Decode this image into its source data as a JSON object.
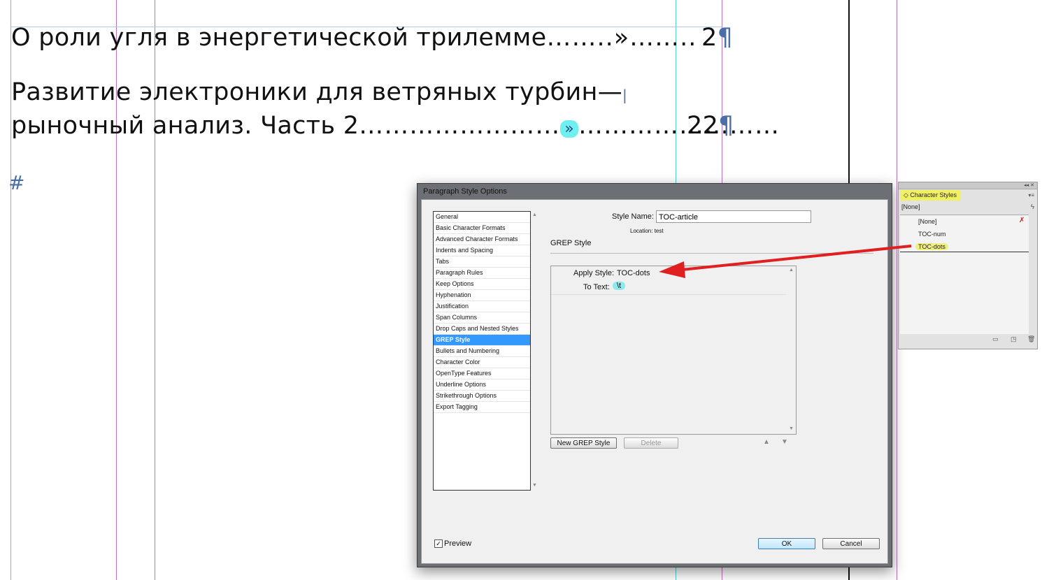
{
  "document": {
    "line1": {
      "text": "О роли угля в энергетической трилемме",
      "leader": "……..»……..",
      "page": "2"
    },
    "line2": {
      "text": "Развитие электроники для ветряных турбин—"
    },
    "line3": {
      "text": "рыночный анализ. Часть 2",
      "leader_before": "……………………",
      "tab_marker": "»",
      "leader_after": "……………………",
      "page": "22"
    },
    "pilcrow": "¶",
    "hash": "#"
  },
  "dialog": {
    "title": "Paragraph Style Options",
    "categories": [
      "General",
      "Basic Character Formats",
      "Advanced Character Formats",
      "Indents and Spacing",
      "Tabs",
      "Paragraph Rules",
      "Keep Options",
      "Hyphenation",
      "Justification",
      "Span Columns",
      "Drop Caps and Nested Styles",
      "GREP Style",
      "Bullets and Numbering",
      "Character Color",
      "OpenType Features",
      "Underline Options",
      "Strikethrough Options",
      "Export Tagging"
    ],
    "selected_category": "GREP Style",
    "style_name_label": "Style Name:",
    "style_name_value": "TOC-article",
    "location_label": "Location:",
    "location_value": "test",
    "section_title": "GREP Style",
    "apply_style_label": "Apply Style:",
    "apply_style_value": "TOC-dots",
    "to_text_label": "To Text:",
    "to_text_value": "\\t",
    "new_grep_button": "New GREP Style",
    "delete_button": "Delete",
    "preview_label": "Preview",
    "preview_checked": true,
    "ok_button": "OK",
    "cancel_button": "Cancel"
  },
  "panel": {
    "title": "Character Styles",
    "current": "[None]",
    "items": [
      "[None]",
      "TOC-num",
      "TOC-dots"
    ]
  },
  "colors": {
    "accent_selection": "#3399ff",
    "highlight_cyan": "#6ff0f0",
    "highlight_yellow": "#f0f060",
    "arrow": "#e02020",
    "guide_magenta": "#c060c0",
    "guide_cyan": "#40d0d0"
  }
}
